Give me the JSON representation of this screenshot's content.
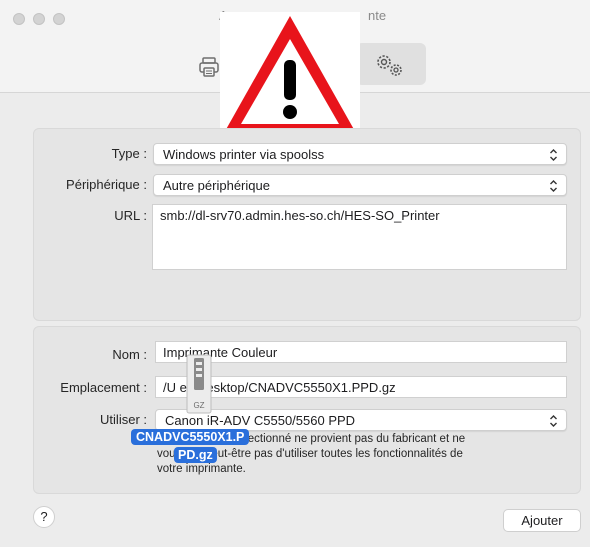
{
  "window": {
    "title_visible_left": "A",
    "title_visible_right": "nte"
  },
  "toolbar": {
    "icons": [
      "printer-icon",
      "gears-icon"
    ]
  },
  "overlay": {
    "icon": "warning-icon",
    "colors": {
      "triangle": "#e8141b",
      "inner": "#ffffff",
      "mark": "#000000"
    }
  },
  "connection": {
    "type_label": "Type :",
    "type_value": "Windows printer via spoolss",
    "device_label": "Périphérique :",
    "device_value": "Autre périphérique",
    "url_label": "URL :",
    "url_value": "smb://dl-srv70.admin.hes-so.ch/HES-SO_Printer"
  },
  "details": {
    "name_label": "Nom :",
    "name_value": "Imprimante Couleur",
    "location_label": "Emplacement :",
    "location_value": "/U          es/Desktop/CNADVC5550X1.PPD.gz",
    "use_label": "Utiliser :",
    "use_value": "Canon iR-ADV C5550/5560 PPD",
    "info_line1": "Le              imprimante sélectionné ne provient pas du fabricant et ne",
    "info_line2": "vou            ettra peut-être pas d'utiliser toutes les fonctionnalités de",
    "info_line3": "votre imprimante."
  },
  "drag": {
    "icon_label": "GZ",
    "file_label_1": "CNADVC5550X1.P",
    "file_label_2": "PD.gz"
  },
  "footer": {
    "help_label": "?",
    "add_label": "Ajouter"
  }
}
